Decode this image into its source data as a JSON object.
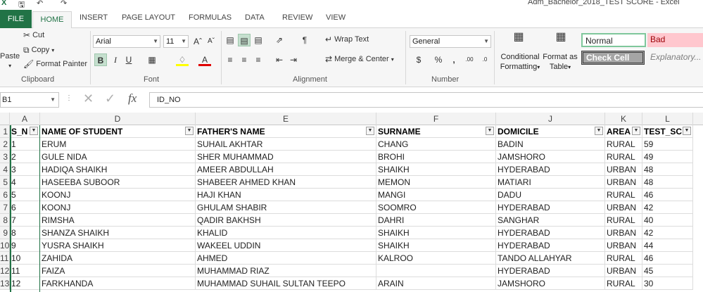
{
  "window": {
    "title": "Adm_Bachelor_2018_TEST SCORE - Excel"
  },
  "tabs": [
    "FILE",
    "HOME",
    "INSERT",
    "PAGE LAYOUT",
    "FORMULAS",
    "DATA",
    "REVIEW",
    "VIEW"
  ],
  "clipboard": {
    "paste": "Paste",
    "cut": "Cut",
    "copy": "Copy",
    "format_painter": "Format Painter",
    "label": "Clipboard"
  },
  "font": {
    "name": "Arial",
    "size": "11",
    "label": "Font"
  },
  "alignment": {
    "wrap_text": "Wrap Text",
    "merge_center": "Merge & Center",
    "label": "Alignment"
  },
  "number": {
    "format": "General",
    "label": "Number"
  },
  "styles": {
    "conditional": "Conditional",
    "formatting": "Formatting",
    "format_as": "Format as",
    "table": "Table",
    "normal": "Normal",
    "bad": "Bad",
    "check_cell": "Check Cell",
    "explanatory": "Explanatory..."
  },
  "formula_bar": {
    "name_box": "B1",
    "content": "ID_NO"
  },
  "column_letters": [
    "A",
    "D",
    "E",
    "F",
    "J",
    "K",
    "L"
  ],
  "row_numbers": [
    "1",
    "2",
    "3",
    "4",
    "5",
    "6",
    "7",
    "8",
    "9",
    "10",
    "11",
    "12",
    "13"
  ],
  "sheet": {
    "headers": [
      "S_N",
      "NAME OF STUDENT",
      "FATHER'S NAME",
      "SURNAME",
      "DOMICILE",
      "AREA",
      "TEST_SC"
    ],
    "rows": [
      [
        "1",
        "ERUM",
        "SUHAIL AKHTAR",
        "CHANG",
        "BADIN",
        "RURAL",
        "59"
      ],
      [
        "2",
        "GULE NIDA",
        "SHER MUHAMMAD",
        "BROHI",
        "JAMSHORO",
        "RURAL",
        "49"
      ],
      [
        "3",
        "HADIQA SHAIKH",
        "AMEER ABDULLAH",
        "SHAIKH",
        "HYDERABAD",
        "URBAN",
        "48"
      ],
      [
        "4",
        "HASEEBA SUBOOR",
        "SHABEER AHMED KHAN",
        "MEMON",
        "MATIARI",
        "URBAN",
        "48"
      ],
      [
        "5",
        "KOONJ",
        "HAJI KHAN",
        "MANGI",
        "DADU",
        "RURAL",
        "46"
      ],
      [
        "6",
        "KOONJ",
        "GHULAM SHABIR",
        "SOOMRO",
        "HYDERABAD",
        "URBAN",
        "42"
      ],
      [
        "7",
        "RIMSHA",
        "QADIR BAKHSH",
        "DAHRI",
        "SANGHAR",
        "RURAL",
        "40"
      ],
      [
        "8",
        "SHANZA SHAIKH",
        "KHALID",
        "SHAIKH",
        "HYDERABAD",
        "URBAN",
        "42"
      ],
      [
        "9",
        "YUSRA SHAIKH",
        "WAKEEL UDDIN",
        "SHAIKH",
        "HYDERABAD",
        "URBAN",
        "44"
      ],
      [
        "10",
        "ZAHIDA",
        "AHMED",
        "KALROO",
        "TANDO ALLAHYAR",
        "RURAL",
        "46"
      ],
      [
        "11",
        "FAIZA",
        "MUHAMMAD RIAZ",
        "",
        "HYDERABAD",
        "URBAN",
        "45"
      ],
      [
        "12",
        "FARKHANDA",
        "MUHAMMAD SUHAIL SULTAN TEEPO",
        "ARAIN",
        "JAMSHORO",
        "RURAL",
        "30"
      ]
    ]
  },
  "colors": {
    "accent": "#217346",
    "selected_fill": "#c5dfce",
    "bad_fill": "#ffc7ce",
    "bad_text": "#9c0006"
  }
}
